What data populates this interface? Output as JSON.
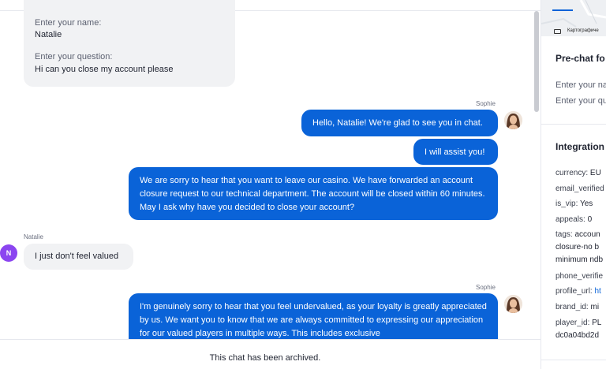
{
  "form": {
    "name_label": "Enter your name:",
    "name_value": "Natalie",
    "question_label": "Enter your question:",
    "question_value": "Hi can you close my account please"
  },
  "messages": [
    {
      "sender": "Sophie",
      "text": "Hello, Natalie! We're glad to see you in chat."
    },
    {
      "text": "I will assist you!"
    },
    {
      "text": "We are sorry to hear that you want to leave our casino. We have forwarded an account closure request to our technical department. The account will be closed within 60 minutes. May I ask why have you decided to close your account?"
    },
    {
      "sender": "Natalie",
      "avatar_initial": "N",
      "text": "I just don't feel valued"
    },
    {
      "sender": "Sophie",
      "text": "I'm genuinely sorry to hear that you feel undervalued, as your loyalty is greatly appreciated by us. We want you to know that we are always committed to expressing our appreciation for our valued players in multiple ways. This includes exclusive"
    }
  ],
  "archived_notice": "This chat has been archived.",
  "panel": {
    "map_caption": "Картографиче",
    "prechat_title": "Pre-chat fo",
    "prechat_fields": [
      "Enter your na",
      "Enter your qu"
    ],
    "integration_title": "Integration",
    "rows": [
      {
        "key": "currency:",
        "value": "EU"
      },
      {
        "key": "email_verified",
        "value": ""
      },
      {
        "key": "is_vip:",
        "value": "Yes"
      },
      {
        "key": "appeals:",
        "value": "0"
      },
      {
        "key": "tags:",
        "value": "accoun"
      },
      {
        "key": "",
        "value": "closure-no b"
      },
      {
        "key": "",
        "value": "minimum ndb"
      },
      {
        "key": "phone_verifie",
        "value": ""
      },
      {
        "key": "profile_url:",
        "value": "ht"
      },
      {
        "key": "brand_id:",
        "value": "mi"
      },
      {
        "key": "player_id:",
        "value": "PL"
      },
      {
        "key": "",
        "value": "dc0a04bd2d"
      }
    ]
  },
  "colors": {
    "accent": "#0a63d8",
    "bubble_in": "#f1f2f4",
    "avatar_n": "#8b45f0"
  }
}
